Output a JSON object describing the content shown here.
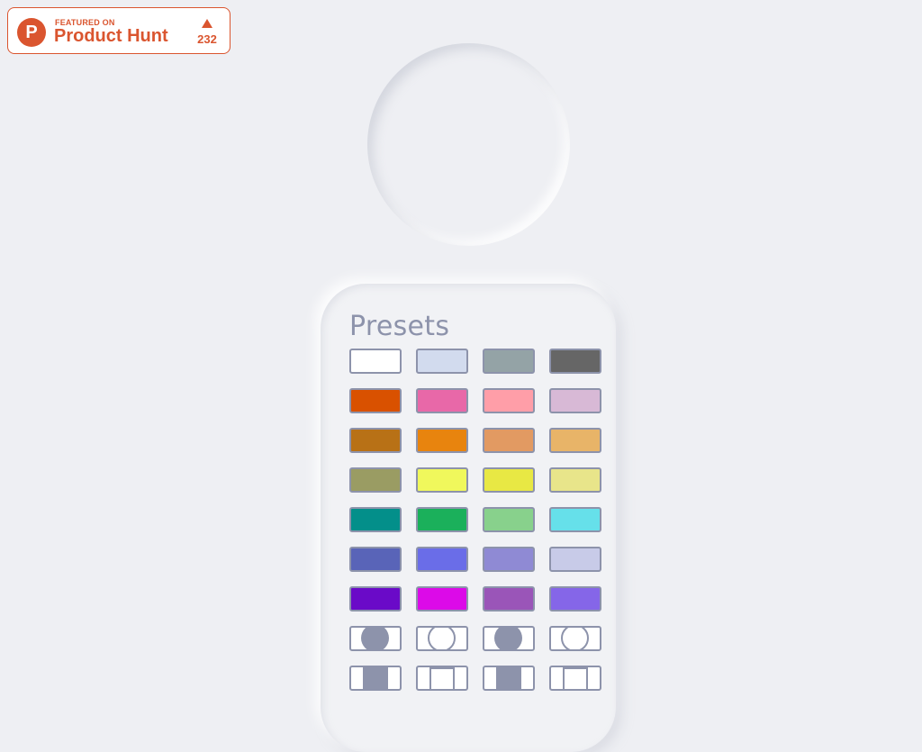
{
  "badge": {
    "small_text": "FEATURED ON",
    "big_text": "Product Hunt",
    "logo_letter": "P",
    "upvote_icon": "triangle-up-icon",
    "count": "232",
    "brand_color": "#da552f"
  },
  "presets": {
    "title": "Presets",
    "border_color": "#8d93ab",
    "color_rows": [
      [
        "#ffffff",
        "#d2dbee",
        "#94a3a6",
        "#666666"
      ],
      [
        "#d95100",
        "#e868a8",
        "#ff9ea8",
        "#d8b9d6"
      ],
      [
        "#b87116",
        "#e8840e",
        "#e29a62",
        "#e8b468"
      ],
      [
        "#9a9c63",
        "#f0f85c",
        "#e8e844",
        "#e8e58a"
      ],
      [
        "#038f8a",
        "#1bb05b",
        "#88d18c",
        "#66e0ea"
      ],
      [
        "#5964b8",
        "#6a6de8",
        "#8f8ad4",
        "#c8cbe8"
      ],
      [
        "#6a0ac8",
        "#dc0ae8",
        "#9a55b8",
        "#8566e8"
      ]
    ],
    "shape_rows": [
      [
        "circle-filled",
        "circle-outline",
        "circle-filled",
        "circle-outline"
      ],
      [
        "square-filled",
        "square-outline",
        "square-filled",
        "square-outline"
      ]
    ]
  }
}
